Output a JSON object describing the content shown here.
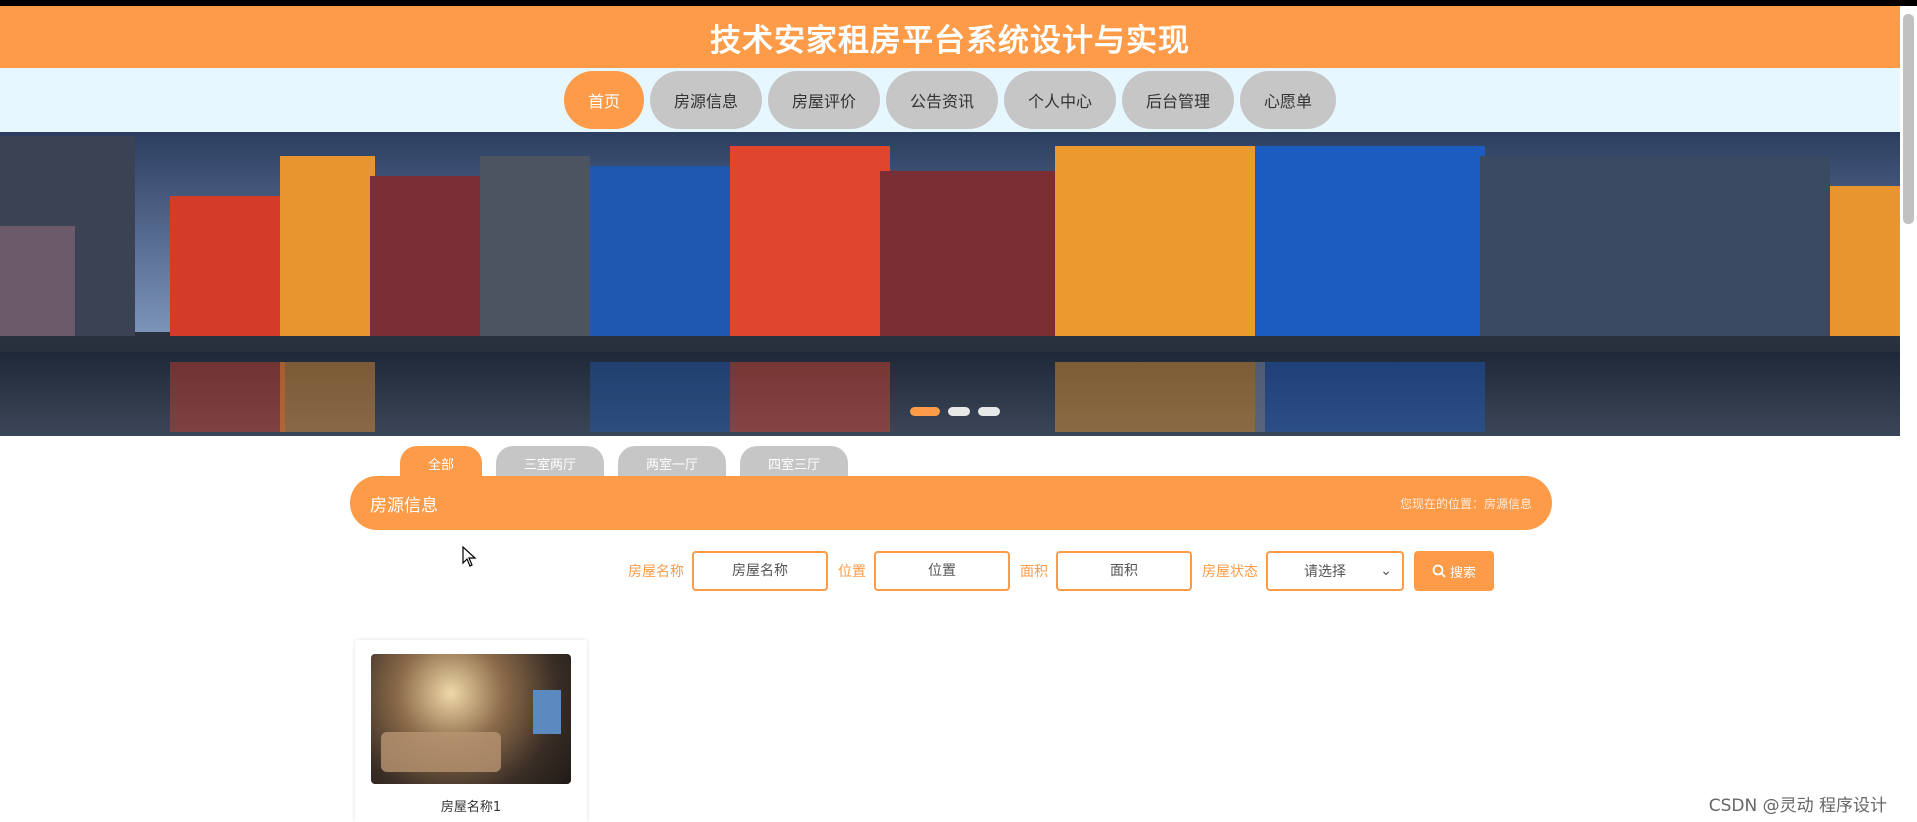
{
  "header": {
    "title": "技术安家租房平台系统设计与实现"
  },
  "nav": {
    "items": [
      {
        "label": "首页",
        "active": true
      },
      {
        "label": "房源信息",
        "active": false
      },
      {
        "label": "房屋评价",
        "active": false
      },
      {
        "label": "公告资讯",
        "active": false
      },
      {
        "label": "个人中心",
        "active": false
      },
      {
        "label": "后台管理",
        "active": false
      },
      {
        "label": "心愿单",
        "active": false
      }
    ]
  },
  "banner": {
    "active_slide": 1,
    "slide_count": 3
  },
  "tabs": [
    "全部",
    "三室两厅",
    "两室一厅",
    "四室三厅"
  ],
  "section": {
    "title": "房源信息",
    "breadcrumb": "您现在的位置：房源信息"
  },
  "search": {
    "name_label": "房屋名称",
    "name_placeholder": "房屋名称",
    "location_label": "位置",
    "location_placeholder": "位置",
    "area_label": "面积",
    "area_placeholder": "面积",
    "status_label": "房屋状态",
    "status_value": "请选择",
    "button_label": "搜索"
  },
  "cards": [
    {
      "name": "房屋名称1"
    }
  ],
  "watermark": "CSDN @灵动 程序设计",
  "colors": {
    "accent": "#fd9b48",
    "nav_inactive": "#c6c6c6",
    "nav_bg": "#e7f7ff"
  }
}
